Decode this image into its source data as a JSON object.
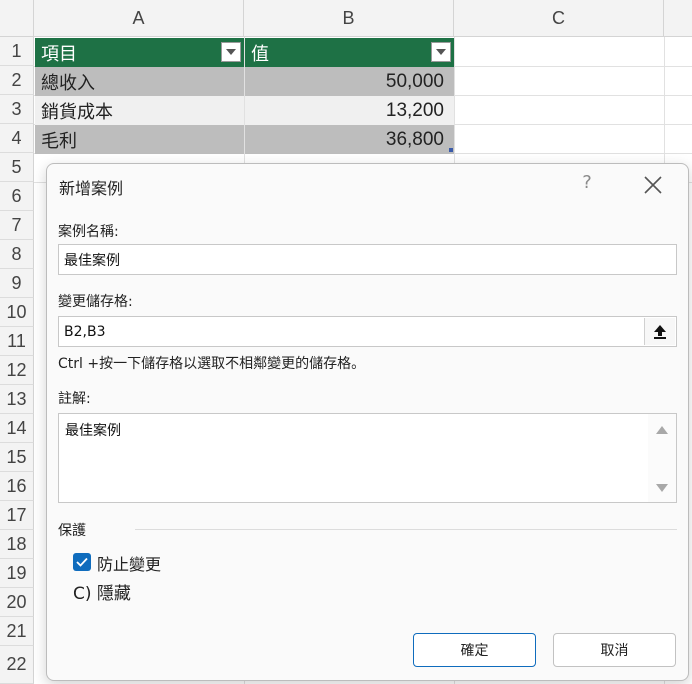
{
  "columns": [
    "A",
    "B",
    "C"
  ],
  "rows": [
    "1",
    "2",
    "3",
    "4",
    "5",
    "6",
    "7",
    "8",
    "9",
    "10",
    "11",
    "12",
    "13",
    "14",
    "15",
    "16",
    "17",
    "18",
    "19",
    "20",
    "21",
    "22"
  ],
  "table": {
    "headers": [
      "項目",
      "值"
    ],
    "data": [
      {
        "label": "總收入",
        "value": "50,000"
      },
      {
        "label": "銷貨成本",
        "value": "13,200"
      },
      {
        "label": "毛利",
        "value": "36,800"
      }
    ]
  },
  "dialog": {
    "title": "新增案例",
    "help": "?",
    "scenario_name_label": "案例名稱:",
    "scenario_name_value": "最佳案例",
    "changing_cells_label": "變更儲存格:",
    "changing_cells_value": "B2,B3",
    "hint": "Ctrl +按一下儲存格以選取不相鄰變更的儲存格。",
    "comment_label": "註解:",
    "comment_value": "最佳案例",
    "protection_label": "保護",
    "prevent_changes_label": "防止變更",
    "prevent_changes_checked": true,
    "hide_label": "C) 隱藏",
    "ok_label": "確定",
    "cancel_label": "取消"
  },
  "colors": {
    "header_green": "#1e7145",
    "accent_blue": "#0f6cbd",
    "band_dark": "#bdbdbd",
    "band_light": "#f0f0f0"
  }
}
